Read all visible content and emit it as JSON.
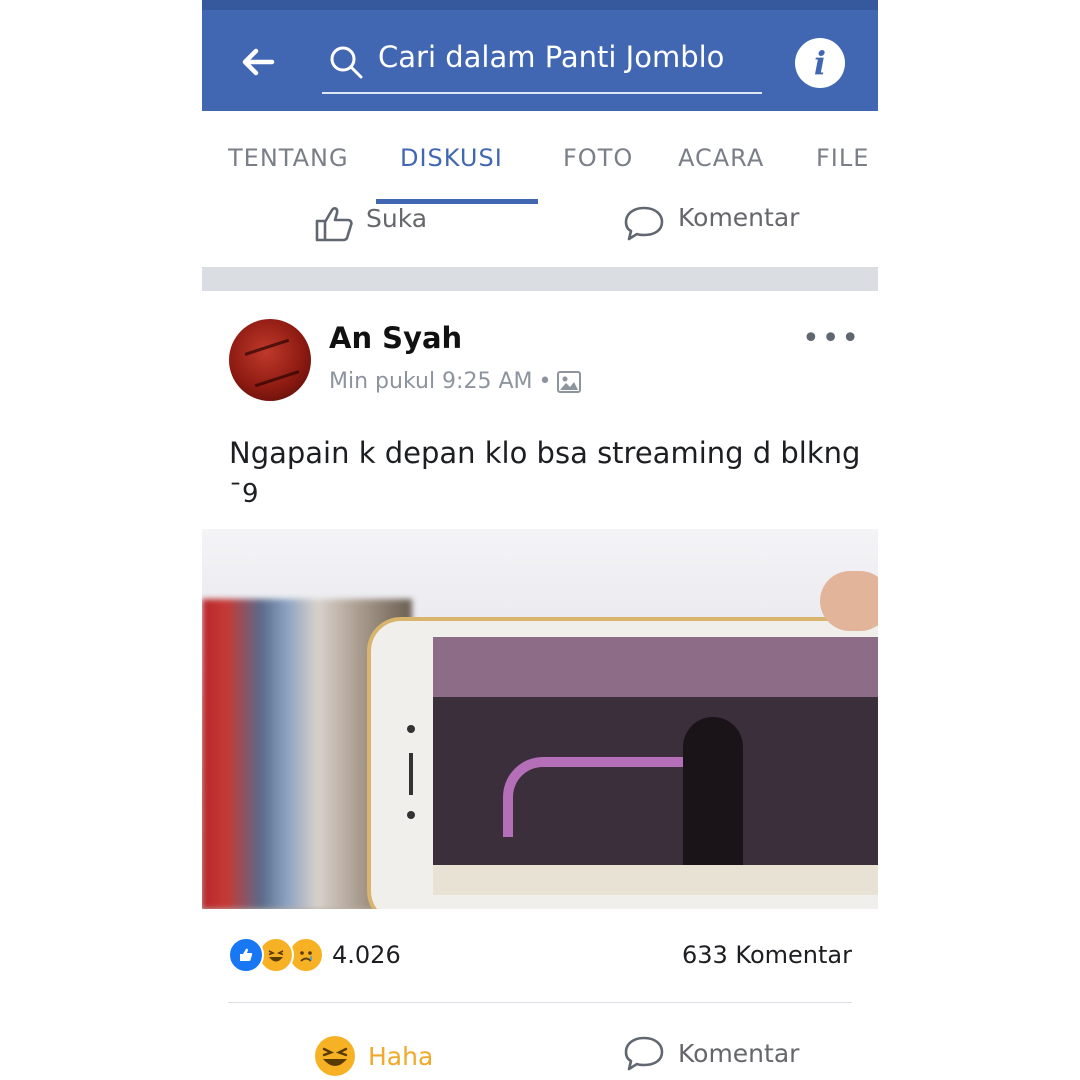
{
  "search": {
    "text": "Cari dalam Panti Jomblo"
  },
  "tabs": [
    "TENTANG",
    "DISKUSI",
    "FOTO",
    "ACARA",
    "FILE"
  ],
  "prev_post_actions": {
    "like": "Suka",
    "comment": "Komentar"
  },
  "post": {
    "author": "An Syah",
    "time": "Min pukul 9:25 AM",
    "message": "Ngapain k depan klo bsa streaming d blkng",
    "message_extra": "¯9",
    "photo_alt_text": "",
    "reactions": {
      "icons": [
        "like-icon",
        "haha-icon",
        "sad-icon"
      ],
      "count": "4.026"
    },
    "comments": "633 Komentar",
    "actions": {
      "reaction": "Haha",
      "comment": "Komentar"
    }
  },
  "colors": {
    "brand": "#4267b2",
    "haha": "#f7b125"
  }
}
